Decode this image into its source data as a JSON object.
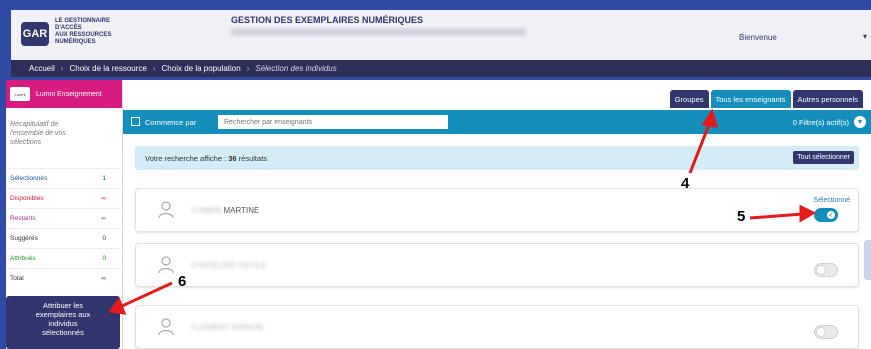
{
  "header": {
    "logo": "GAR",
    "logo_text": "LE GESTIONNAIRE\nD'ACCÈS\nAUX RESSOURCES\nNUMÉRIQUES",
    "title": "GESTION DES EXEMPLAIRES NUMÉRIQUES",
    "welcome": "Bienvenue"
  },
  "breadcrumb": [
    "Accueil",
    "Choix de la ressource",
    "Choix de la population",
    "Sélection des individus"
  ],
  "sidebar": {
    "resource": "Lumni Enseignement",
    "recap": "Récapitulatif de\nl'ensemble de vos\nsélections",
    "stats": [
      {
        "label": "Sélectionnés",
        "value": "1",
        "color": "#1e4ea0"
      },
      {
        "label": "Disponibles",
        "value": "∞",
        "color": "#d11c3b"
      },
      {
        "label": "Restants",
        "value": "∞",
        "color": "#9b2fa3"
      },
      {
        "label": "Suggérés",
        "value": "0",
        "color": "#333333"
      },
      {
        "label": "Attribués",
        "value": "0",
        "color": "#2e8b2e"
      },
      {
        "label": "Total",
        "value": "∞",
        "color": "#333333"
      }
    ],
    "assign_button": "Attribuer les\nexemplaires aux\nindividus\nsélectionnés"
  },
  "tabs": [
    {
      "label": "Groupes",
      "active": false
    },
    {
      "label": "Tous les enseignants",
      "active": true
    },
    {
      "label": "Autres personnels",
      "active": false
    }
  ],
  "toolbar": {
    "starts_with": "Commence par",
    "search_placeholder": "Rechercher par enseignants",
    "filters": "0 Filtre(s) actif(s)"
  },
  "results": {
    "prefix": "Votre recherche affiche : ",
    "count": "36",
    "suffix": " résultats",
    "select_all": "Tout sélectionner"
  },
  "cards": [
    {
      "surname": "CHABIN",
      "firstname": "MARTINE",
      "state": "Sélectionné",
      "selected": true
    },
    {
      "surname": "CHATELIER CECILE",
      "firstname": "",
      "state": "",
      "selected": false
    },
    {
      "surname": "CLEMENT MARION",
      "firstname": "",
      "state": "",
      "selected": false
    }
  ],
  "annotations": [
    "4",
    "5",
    "6"
  ],
  "colors": {
    "frame": "#2f4ba6",
    "nav": "#2d2f59",
    "primary": "#33356e",
    "accent": "#148fbc",
    "resource": "#d81b7e",
    "arrow": "#e21b1b"
  }
}
